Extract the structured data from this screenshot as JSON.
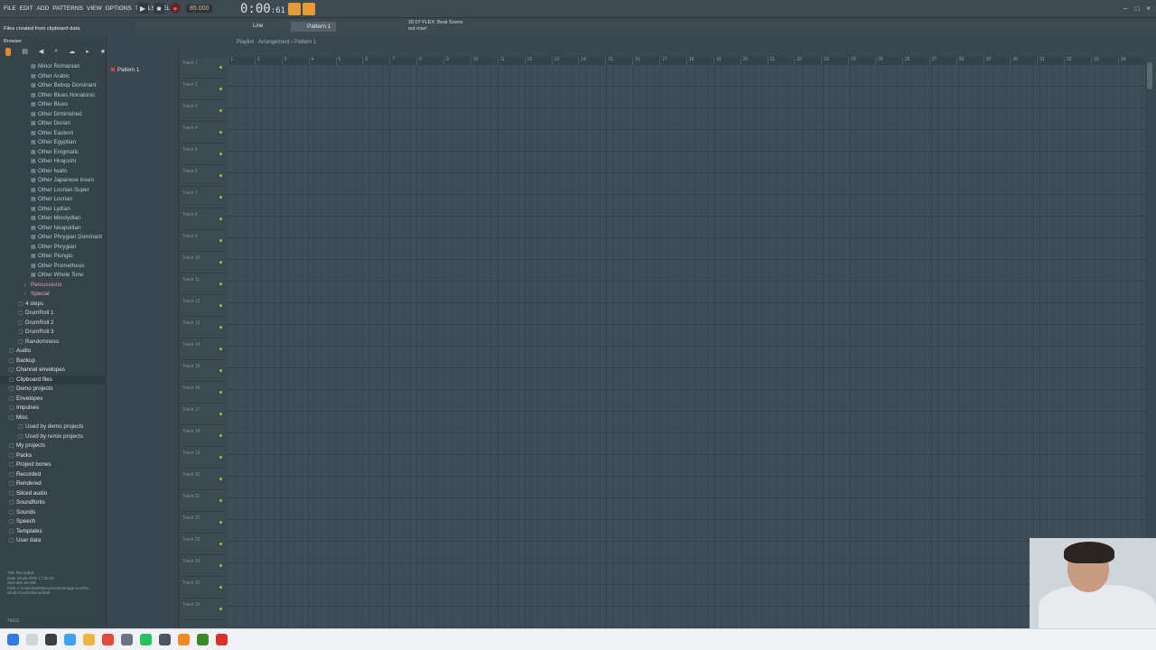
{
  "menu": [
    "FILE",
    "EDIT",
    "ADD",
    "PATTERNS",
    "VIEW",
    "OPTIONS",
    "TOOLS",
    "HELP"
  ],
  "transport": {
    "tempo": "85.000",
    "time": "0:00",
    "time_sub": ":61"
  },
  "status": "Files created from clipboard data",
  "pattern_selector": "Pattern 1",
  "snap": "Line",
  "news": {
    "line1": "20:07  FLEX: Beat Scene",
    "line2": "out now!"
  },
  "browser_title": "Browser",
  "tree": [
    {
      "label": "Minor Romanian",
      "lvl": "lvl3"
    },
    {
      "label": "Other Arabic",
      "lvl": "lvl3"
    },
    {
      "label": "Other Bebop Dominant",
      "lvl": "lvl3"
    },
    {
      "label": "Other Blues Nonatonic",
      "lvl": "lvl3"
    },
    {
      "label": "Other Blues",
      "lvl": "lvl3"
    },
    {
      "label": "Other Diminished",
      "lvl": "lvl3"
    },
    {
      "label": "Other Dorian",
      "lvl": "lvl3"
    },
    {
      "label": "Other Eastern",
      "lvl": "lvl3"
    },
    {
      "label": "Other Egyptian",
      "lvl": "lvl3"
    },
    {
      "label": "Other Enigmatic",
      "lvl": "lvl3"
    },
    {
      "label": "Other Hirajoshi",
      "lvl": "lvl3"
    },
    {
      "label": "Other Iwato",
      "lvl": "lvl3"
    },
    {
      "label": "Other Japanese Insen",
      "lvl": "lvl3"
    },
    {
      "label": "Other Locrian Super",
      "lvl": "lvl3"
    },
    {
      "label": "Other Locrian",
      "lvl": "lvl3"
    },
    {
      "label": "Other Lydian",
      "lvl": "lvl3"
    },
    {
      "label": "Other Mixolydian",
      "lvl": "lvl3"
    },
    {
      "label": "Other Neapolitan",
      "lvl": "lvl3"
    },
    {
      "label": "Other Phrygian Dominant",
      "lvl": "lvl3"
    },
    {
      "label": "Other Phrygian",
      "lvl": "lvl3"
    },
    {
      "label": "Other Piongio",
      "lvl": "lvl3"
    },
    {
      "label": "Other Prometheus",
      "lvl": "lvl3"
    },
    {
      "label": "Other Whole Tone",
      "lvl": "lvl3"
    },
    {
      "label": "Percussions",
      "lvl": "lvl2"
    },
    {
      "label": "Special",
      "lvl": "lvl2"
    },
    {
      "label": "4 steps",
      "lvl": "lvl2b"
    },
    {
      "label": "DrumRoll 1",
      "lvl": "lvl2b"
    },
    {
      "label": "DrumRoll 2",
      "lvl": "lvl2b"
    },
    {
      "label": "DrumRoll 3",
      "lvl": "lvl2b"
    },
    {
      "label": "Randomness",
      "lvl": "lvl2b"
    },
    {
      "label": "Audio",
      "lvl": "lvl1"
    },
    {
      "label": "Backup",
      "lvl": "lvl1"
    },
    {
      "label": "Channel envelopes",
      "lvl": "lvl1"
    },
    {
      "label": "Clipboard files",
      "lvl": "lvl1"
    },
    {
      "label": "Demo projects",
      "lvl": "lvl1"
    },
    {
      "label": "Envelopes",
      "lvl": "lvl1"
    },
    {
      "label": "Impulses",
      "lvl": "lvl1"
    },
    {
      "label": "Misc",
      "lvl": "lvl1"
    },
    {
      "label": "Used by demo projects",
      "lvl": "lvl2b"
    },
    {
      "label": "Used by remix projects",
      "lvl": "lvl2b"
    },
    {
      "label": "My projects",
      "lvl": "lvl1"
    },
    {
      "label": "Packs",
      "lvl": "lvl1"
    },
    {
      "label": "Project bones",
      "lvl": "lvl1"
    },
    {
      "label": "Recorded",
      "lvl": "lvl1"
    },
    {
      "label": "Rendered",
      "lvl": "lvl1"
    },
    {
      "label": "Sliced audio",
      "lvl": "lvl1"
    },
    {
      "label": "Soundfonts",
      "lvl": "lvl1"
    },
    {
      "label": "Sounds",
      "lvl": "lvl1"
    },
    {
      "label": "Speech",
      "lvl": "lvl1"
    },
    {
      "label": "Templates",
      "lvl": "lvl1"
    },
    {
      "label": "User data",
      "lvl": "lvl1"
    }
  ],
  "info": {
    "l1": "Title   Recorded",
    "l2": "Date    19.05.2025 17:05:22",
    "l3": "Size    501.98 MB",
    "l4": "Path    C:\\Users\\MO\\Documents\\Image-Line\\FL Studio\\Audio\\Recorded\\"
  },
  "tags_label": "TAGS",
  "playlist_title": "Playlist · Arrangement › Pattern 1",
  "pattern_item": "Pattern 1",
  "tracks": [
    "Track 1",
    "Track 2",
    "Track 3",
    "Track 4",
    "Track 5",
    "Track 6",
    "Track 7",
    "Track 8",
    "Track 9",
    "Track 10",
    "Track 11",
    "Track 12",
    "Track 13",
    "Track 14",
    "Track 15",
    "Track 16",
    "Track 17",
    "Track 18",
    "Track 19",
    "Track 20",
    "Track 21",
    "Track 22",
    "Track 23",
    "Track 24",
    "Track 25",
    "Track 26"
  ],
  "bars": [
    "1",
    "2",
    "3",
    "4",
    "5",
    "6",
    "7",
    "8",
    "9",
    "10",
    "11",
    "12",
    "13",
    "14",
    "15",
    "16",
    "17",
    "18",
    "19",
    "20",
    "21",
    "22",
    "23",
    "24",
    "25",
    "26",
    "27",
    "28",
    "29",
    "30",
    "31",
    "32",
    "33",
    "34"
  ]
}
